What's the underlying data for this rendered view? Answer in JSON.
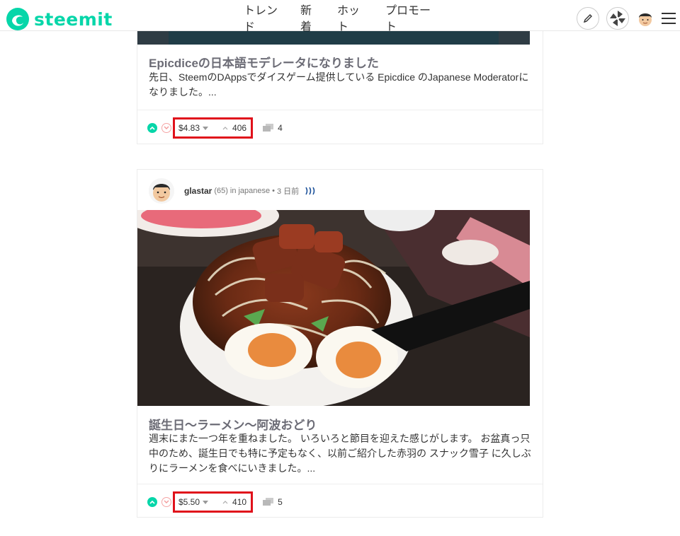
{
  "header": {
    "logo_text": "steemit",
    "nav": [
      "トレンド",
      "新着",
      "ホット",
      "プロモート"
    ],
    "icons": [
      "pencil-icon",
      "wallet-pinwheel-icon",
      "user-avatar",
      "hamburger-menu-icon"
    ]
  },
  "posts": [
    {
      "title": "Epicdiceの日本語モデレータになりました",
      "excerpt": "先日、SteemのDAppsでダイスゲーム提供している Epicdice のJapanese Moderatorになりました。...",
      "payout": "$4.83",
      "votes": "406",
      "comments": "4"
    },
    {
      "author": "glastar",
      "reputation": "(65)",
      "category_prefix": "in",
      "category": "japanese",
      "separator": "•",
      "time": "3 日前",
      "title": "誕生日〜ラーメン〜阿波おどり",
      "excerpt": "週末にまた一つ年を重ねました。 いろいろと節目を迎えた感じがします。 お盆真っ只中のため、誕生日でも特に予定もなく、以前ご紹介した赤羽の スナック雪子 に久しぶりにラーメンを食べにいきました。...",
      "payout": "$5.50",
      "votes": "410",
      "comments": "5"
    }
  ],
  "colors": {
    "brand": "#06d6a9",
    "highlight_box": "#e0111b",
    "title_gray": "#6c6c76"
  }
}
